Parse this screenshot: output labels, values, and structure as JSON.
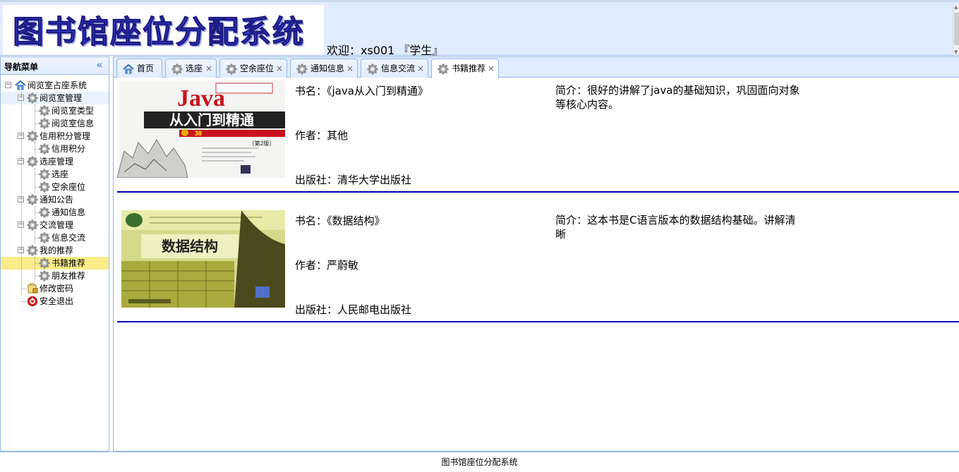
{
  "header": {
    "logo_text": "图书馆座位分配系统",
    "welcome": "欢迎：xs001 『学生』"
  },
  "nav": {
    "title": "导航菜单",
    "tree": [
      {
        "label": "阅览室占座系统",
        "level": 0,
        "icon": "home-icon"
      },
      {
        "label": "阅览室管理",
        "level": 1,
        "icon": "gear-icon"
      },
      {
        "label": "阅览室类型",
        "level": 2,
        "icon": "gear-icon"
      },
      {
        "label": "阅览室信息",
        "level": 2,
        "icon": "gear-icon"
      },
      {
        "label": "信用积分管理",
        "level": 1,
        "icon": "gear-icon"
      },
      {
        "label": "信用积分",
        "level": 2,
        "icon": "gear-icon"
      },
      {
        "label": "选座管理",
        "level": 1,
        "icon": "gear-icon"
      },
      {
        "label": "选座",
        "level": 2,
        "icon": "gear-icon"
      },
      {
        "label": "空余座位",
        "level": 2,
        "icon": "gear-icon"
      },
      {
        "label": "通知公告",
        "level": 1,
        "icon": "gear-icon"
      },
      {
        "label": "通知信息",
        "level": 2,
        "icon": "gear-icon"
      },
      {
        "label": "交流管理",
        "level": 1,
        "icon": "gear-icon"
      },
      {
        "label": "信息交流",
        "level": 2,
        "icon": "gear-icon"
      },
      {
        "label": "我的推荐",
        "level": 1,
        "icon": "gear-icon"
      },
      {
        "label": "书籍推荐",
        "level": 2,
        "icon": "gear-icon",
        "selected": true
      },
      {
        "label": "朋友推荐",
        "level": 2,
        "icon": "gear-icon"
      },
      {
        "label": "修改密码",
        "level": 1,
        "icon": "lock-icon"
      },
      {
        "label": "安全退出",
        "level": 1,
        "icon": "exit-icon"
      }
    ]
  },
  "tabs": [
    {
      "label": "首页",
      "icon": "home-icon",
      "closable": false
    },
    {
      "label": "选座",
      "icon": "gear-icon",
      "closable": true
    },
    {
      "label": "空余座位",
      "icon": "gear-icon",
      "closable": true
    },
    {
      "label": "通知信息",
      "icon": "gear-icon",
      "closable": true
    },
    {
      "label": "信息交流",
      "icon": "gear-icon",
      "closable": true
    },
    {
      "label": "书籍推荐",
      "icon": "gear-icon",
      "closable": true,
      "active": true
    }
  ],
  "books": [
    {
      "title": "书名：《java从入门到精通》",
      "author": "作者：其他",
      "publisher": "出版社：清华大学出版社",
      "intro": "简介：很好的讲解了java的基础知识，巩固面向对象等核心内容。",
      "cover_title": "Java",
      "cover_subtitle": "从入门到精通",
      "cover_edition": "（第2版）",
      "cover_badge": "38"
    },
    {
      "title": "书名：《数据结构》",
      "author": "作者：严蔚敏",
      "publisher": "出版社：人民邮电出版社",
      "intro": "简介：这本书是C语言版本的数据结构基础。讲解清晰",
      "cover_title": "数据结构"
    }
  ],
  "footer": "图书馆座位分配系统"
}
